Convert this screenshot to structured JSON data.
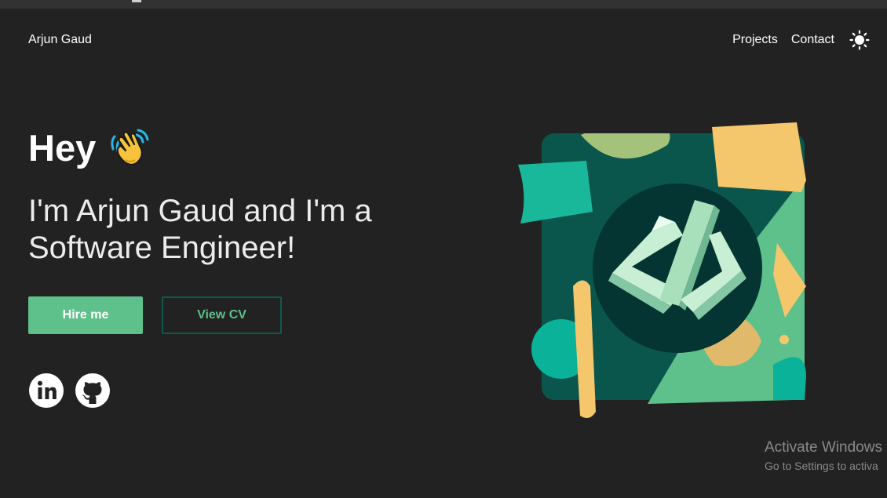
{
  "header": {
    "brand": "Arjun Gaud",
    "nav": [
      {
        "label": "Projects"
      },
      {
        "label": "Contact"
      }
    ],
    "theme_toggle_icon": "sun-icon"
  },
  "hero": {
    "greeting": "Hey",
    "greeting_emoji_icon": "waving-hand-icon",
    "headline": "I'm Arjun Gaud and I'm a Software Engineer!",
    "primary_button": "Hire me",
    "secondary_button": "View CV",
    "social_icons": [
      "linkedin-icon",
      "github-icon"
    ],
    "illustration_icon": "code-brackets-icon"
  },
  "os_watermark": {
    "title": "Activate Windows",
    "subtitle": "Go to Settings to activa"
  },
  "colors": {
    "background": "#222222",
    "accent_green": "#5ec08a",
    "dark_teal": "#0f5a4f",
    "text": "#ffffff"
  }
}
